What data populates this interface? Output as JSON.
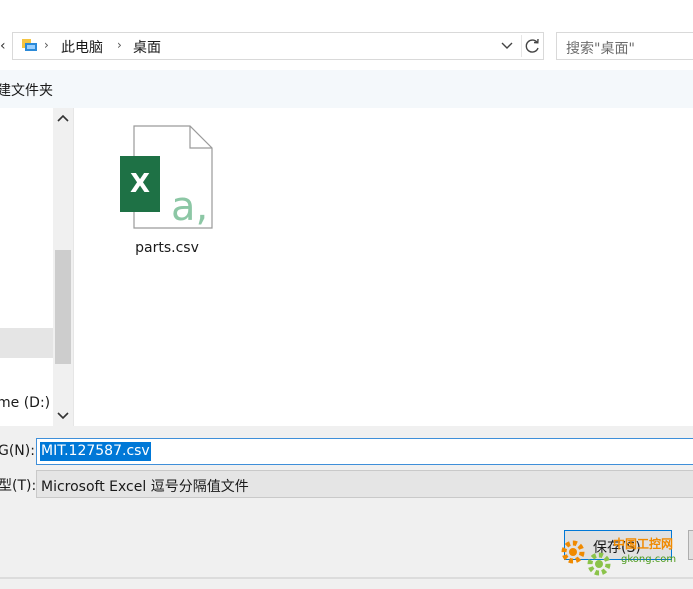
{
  "address_bar": {
    "breadcrumb": [
      "此电脑",
      "桌面"
    ],
    "search_placeholder": "搜索\"桌面\""
  },
  "toolbar": {
    "new_folder_label": "建文件夹"
  },
  "navigation": {
    "drive_label": "me (D:)"
  },
  "files": [
    {
      "name": "parts.csv",
      "icon": "excel-csv-file-icon",
      "icon_badge": "X",
      "icon_letter": "a,"
    }
  ],
  "form": {
    "filename_label": "G(N):",
    "filename_value": "MIT.127587.csv",
    "filetype_label": "型(T):",
    "filetype_value": "Microsoft Excel 逗号分隔值文件"
  },
  "buttons": {
    "save_label": "保存(S)"
  },
  "watermark": {
    "text": "中国工控网",
    "url": "gkong.com"
  },
  "colors": {
    "accent": "#0078d7",
    "excel_green": "#1e7145",
    "toolbar_bg": "#f4f8fb",
    "footer_bg": "#f0f0f0"
  }
}
